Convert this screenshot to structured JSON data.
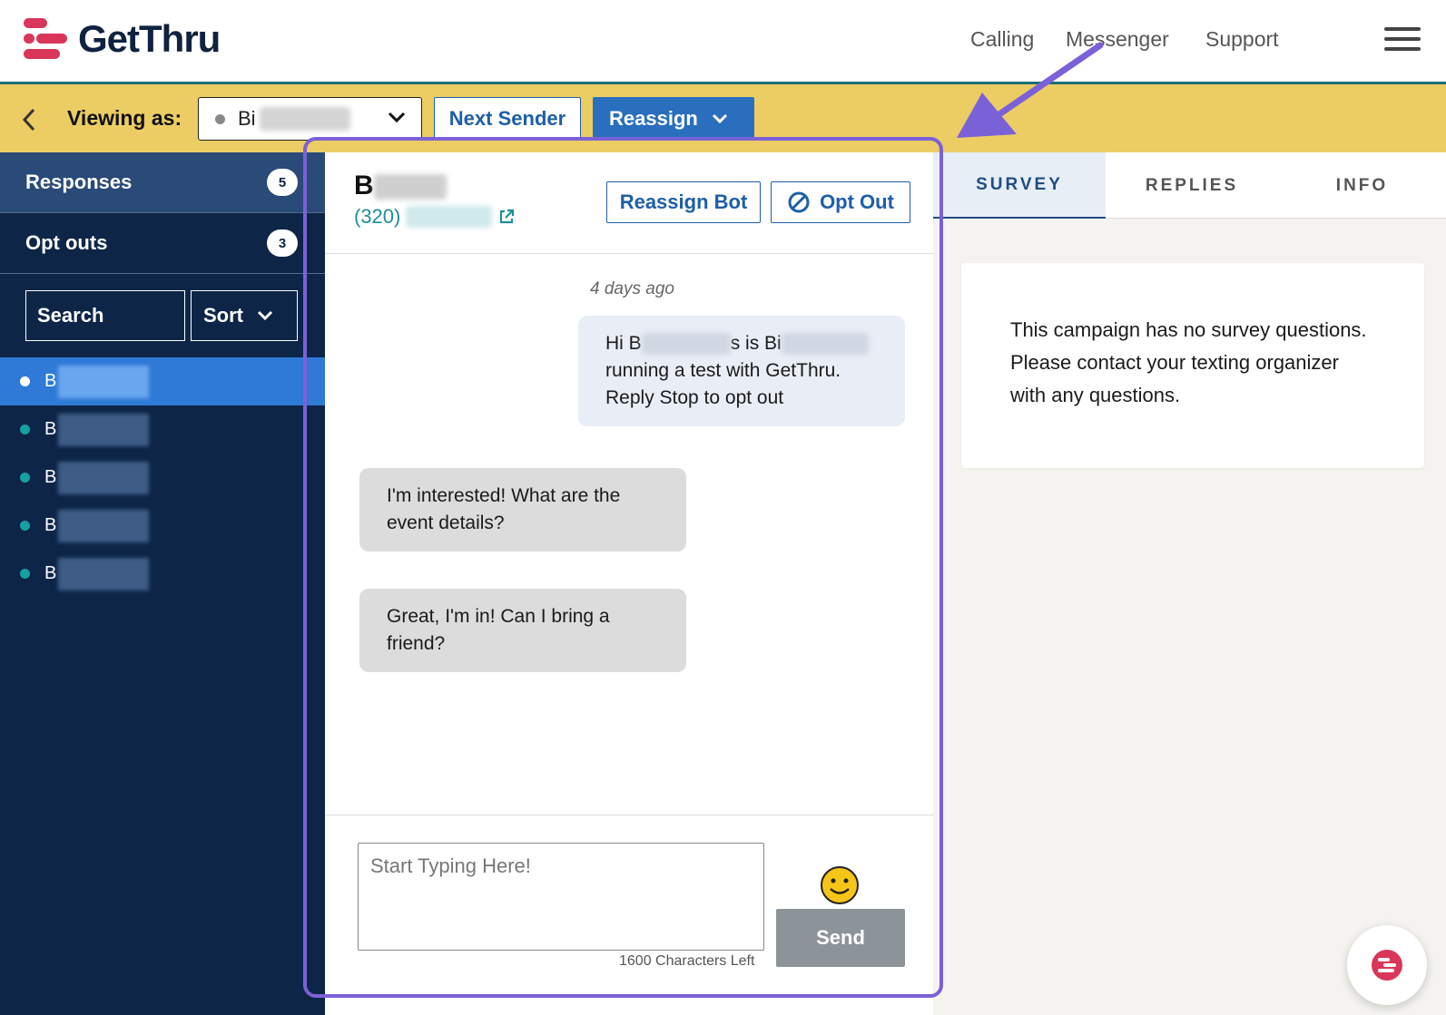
{
  "app": {
    "logo_text": "GetThru",
    "nav": [
      "Calling",
      "Messenger",
      "Support"
    ]
  },
  "viewbar": {
    "label": "Viewing as:",
    "sender_prefix": "Bi",
    "next_sender": "Next Sender",
    "reassign": "Reassign"
  },
  "sidebar": {
    "sections": [
      {
        "label": "Responses",
        "count": "5"
      },
      {
        "label": "Opt outs",
        "count": "3"
      }
    ],
    "search_label": "Search",
    "sort_label": "Sort",
    "contacts": [
      "B",
      "B",
      "B",
      "B",
      "B"
    ]
  },
  "conversation": {
    "contact_name_prefix": "B",
    "area_code": "(320)",
    "reassign_bot": "Reassign Bot",
    "opt_out": "Opt Out",
    "timestamp": "4 days ago",
    "outgoing": {
      "line1_a": "Hi B",
      "line1_b": "s is Bi",
      "line2": "running a test with GetThru.",
      "line3": "Reply Stop to opt out"
    },
    "incoming": [
      "I'm interested! What are the event details?",
      "Great, I'm in! Can I bring a friend?"
    ],
    "composer_placeholder": "Start Typing Here!",
    "chars_left": "1600 Characters Left",
    "send": "Send"
  },
  "panel": {
    "tabs": [
      "SURVEY",
      "REPLIES",
      "INFO"
    ],
    "active_tab": "SURVEY",
    "survey_message": "This campaign has no survey questions. Please contact your texting organizer with any questions."
  },
  "colors": {
    "brand_navy": "#0d2547",
    "accent_blue": "#2a6fbd",
    "viewbar_yellow": "#ebcd64",
    "highlight_purple": "#7b61d8",
    "logo_red": "#d9365a"
  }
}
